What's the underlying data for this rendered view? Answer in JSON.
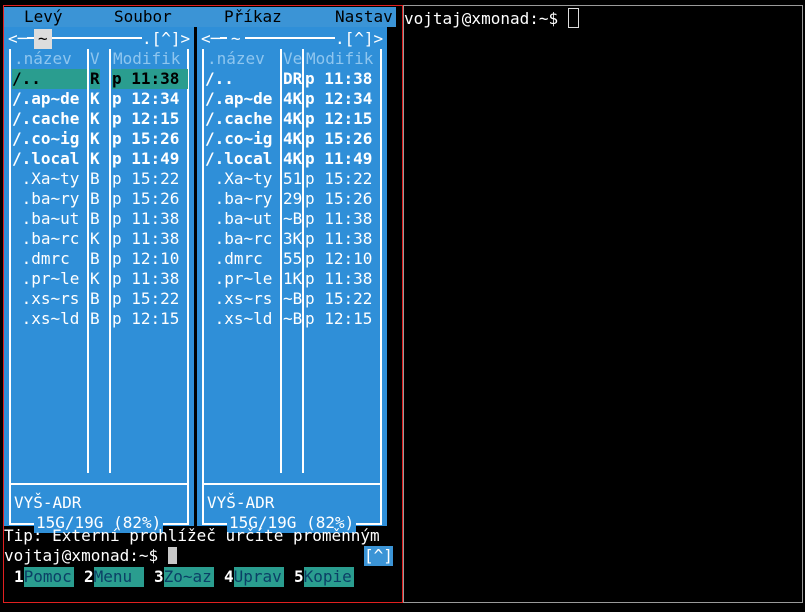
{
  "menu": {
    "left": "Levý",
    "file": "Soubor",
    "command": "Příkaz",
    "options": "Nastav"
  },
  "left_panel": {
    "title": "~",
    "arrow_left": "<─",
    "top_right": ".[^]>",
    "cols": {
      "name": ".název",
      "size": "V",
      "mtime": "Modifik"
    },
    "rows": [
      {
        "name": "/..",
        "size": "R",
        "m": "p",
        "time": "11:38",
        "bold": true,
        "selected": true
      },
      {
        "name": "/.ap~de",
        "size": "K",
        "m": "p",
        "time": "12:34",
        "bold": true
      },
      {
        "name": "/.cache",
        "size": "K",
        "m": "p",
        "time": "12:15",
        "bold": true
      },
      {
        "name": "/.co~ig",
        "size": "K",
        "m": "p",
        "time": "15:26",
        "bold": true
      },
      {
        "name": "/.local",
        "size": "K",
        "m": "p",
        "time": "11:49",
        "bold": true
      },
      {
        "name": " .Xa~ty",
        "size": "B",
        "m": "p",
        "time": "15:22"
      },
      {
        "name": " .ba~ry",
        "size": "B",
        "m": "p",
        "time": "15:26"
      },
      {
        "name": " .ba~ut",
        "size": "B",
        "m": "p",
        "time": "11:38"
      },
      {
        "name": " .ba~rc",
        "size": "K",
        "m": "p",
        "time": "11:38"
      },
      {
        "name": " .dmrc",
        "size": "B",
        "m": "p",
        "time": "12:10"
      },
      {
        "name": " .pr~le",
        "size": "K",
        "m": "p",
        "time": "11:38"
      },
      {
        "name": " .xs~rs",
        "size": "B",
        "m": "p",
        "time": "15:22"
      },
      {
        "name": " .xs~ld",
        "size": "B",
        "m": "p",
        "time": "12:15"
      }
    ],
    "status": "VYŠ-ADR",
    "disk": "15G/19G (82%)"
  },
  "right_panel": {
    "title": "~",
    "arrow_left": "<─",
    "top_right": ".[^]>",
    "cols": {
      "name": ".název",
      "size": "Ve",
      "mtime": "Modifik"
    },
    "rows": [
      {
        "name": "/..",
        "size": "DR",
        "m": "p",
        "time": "11:38",
        "bold": true
      },
      {
        "name": "/.ap~de",
        "size": "4K",
        "m": "p",
        "time": "12:34",
        "bold": true
      },
      {
        "name": "/.cache",
        "size": "4K",
        "m": "p",
        "time": "12:15",
        "bold": true
      },
      {
        "name": "/.co~ig",
        "size": "4K",
        "m": "p",
        "time": "15:26",
        "bold": true
      },
      {
        "name": "/.local",
        "size": "4K",
        "m": "p",
        "time": "11:49",
        "bold": true
      },
      {
        "name": " .Xa~ty",
        "size": "51",
        "m": "p",
        "time": "15:22"
      },
      {
        "name": " .ba~ry",
        "size": "29",
        "m": "p",
        "time": "15:26"
      },
      {
        "name": " .ba~ut",
        "size": "~B",
        "m": "p",
        "time": "11:38"
      },
      {
        "name": " .ba~rc",
        "size": "3K",
        "m": "p",
        "time": "11:38"
      },
      {
        "name": " .dmrc",
        "size": "55",
        "m": "p",
        "time": "12:10"
      },
      {
        "name": " .pr~le",
        "size": "1K",
        "m": "p",
        "time": "11:38"
      },
      {
        "name": " .xs~rs",
        "size": "~B",
        "m": "p",
        "time": "15:22"
      },
      {
        "name": " .xs~ld",
        "size": "~B",
        "m": "p",
        "time": "12:15"
      }
    ],
    "status": "VYŠ-ADR",
    "disk": "15G/19G (82%)"
  },
  "tip": "Tip: Externí prohlížeč určíte proměnným",
  "prompt": "vojtaj@xmonad:~$ ",
  "prompt_badge": "[^]",
  "fkeys": [
    {
      "num": "1",
      "label": "Pomoc"
    },
    {
      "num": "2",
      "label": "Menu"
    },
    {
      "num": "3",
      "label": "Zo~az"
    },
    {
      "num": "4",
      "label": "Uprav"
    },
    {
      "num": "5",
      "label": "Kopie"
    }
  ],
  "terminal_prompt": "vojtaj@xmonad:~$ "
}
